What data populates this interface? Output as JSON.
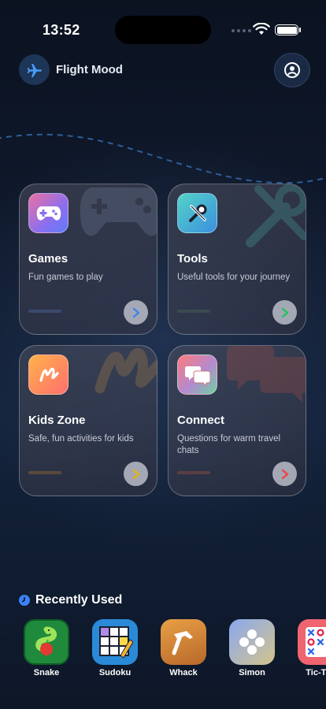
{
  "status_bar": {
    "time": "13:52"
  },
  "header": {
    "app_title": "Flight Mood",
    "logo_icon": "airplane-icon",
    "profile_icon": "user-icon"
  },
  "cards": [
    {
      "id": "games",
      "title": "Games",
      "subtitle": "Fun games to play",
      "icon": "gamepad-icon",
      "accent": "#3b82f6"
    },
    {
      "id": "tools",
      "title": "Tools",
      "subtitle": "Useful tools for your journey",
      "icon": "tools-icon",
      "accent": "#22c55e"
    },
    {
      "id": "kids",
      "title": "Kids Zone",
      "subtitle": "Safe, fun activities for kids",
      "icon": "scribble-icon",
      "accent": "#eab308"
    },
    {
      "id": "connect",
      "title": "Connect",
      "subtitle": "Questions for warm travel chats",
      "icon": "chat-bubbles-icon",
      "accent": "#ef4444"
    }
  ],
  "recently_used": {
    "title": "Recently Used",
    "icon": "clock-icon",
    "items": [
      {
        "label": "Snake",
        "icon": "snake-icon"
      },
      {
        "label": "Sudoku",
        "icon": "sudoku-grid-icon"
      },
      {
        "label": "Whack",
        "icon": "hammer-icon"
      },
      {
        "label": "Simon",
        "icon": "simon-dots-icon"
      },
      {
        "label": "Tic-Tac",
        "icon": "tic-tac-toe-icon"
      }
    ]
  }
}
